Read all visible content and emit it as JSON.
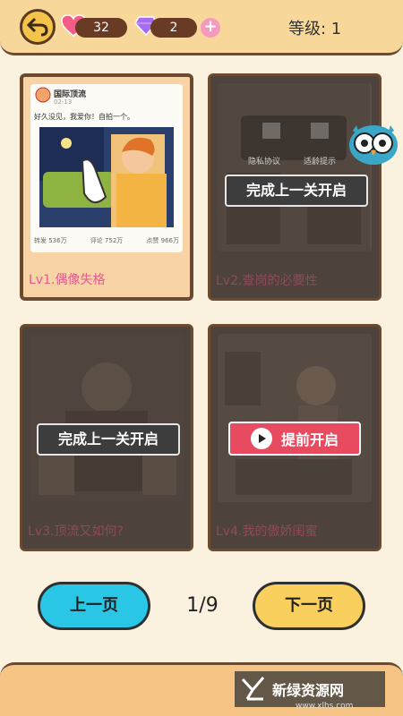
{
  "header": {
    "hearts": "32",
    "gems": "2",
    "plus": "+",
    "level_label": "等级: 1"
  },
  "levels": [
    {
      "caption": "Lv1.偶像失格",
      "post_name": "国际顶流",
      "post_date": "02-13",
      "post_text": "好久没见，我爱你！自拍一个。",
      "stats": [
        "转发 536万",
        "评论 752万",
        "点赞 966万"
      ]
    },
    {
      "caption": "Lv2.查岗的必要性",
      "button": "完成上一关开启",
      "hint_labels": [
        "隐私协议",
        "适龄提示"
      ]
    },
    {
      "caption": "Lv3.顶流又如何?",
      "button": "完成上一关开启"
    },
    {
      "caption": "Lv4.我的傲娇闺蜜",
      "button": "提前开启"
    }
  ],
  "pager": {
    "prev": "上一页",
    "next": "下一页",
    "indicator": "1/9"
  },
  "watermark": {
    "text": "新绿资源网",
    "url": "www.xlhs.com"
  }
}
